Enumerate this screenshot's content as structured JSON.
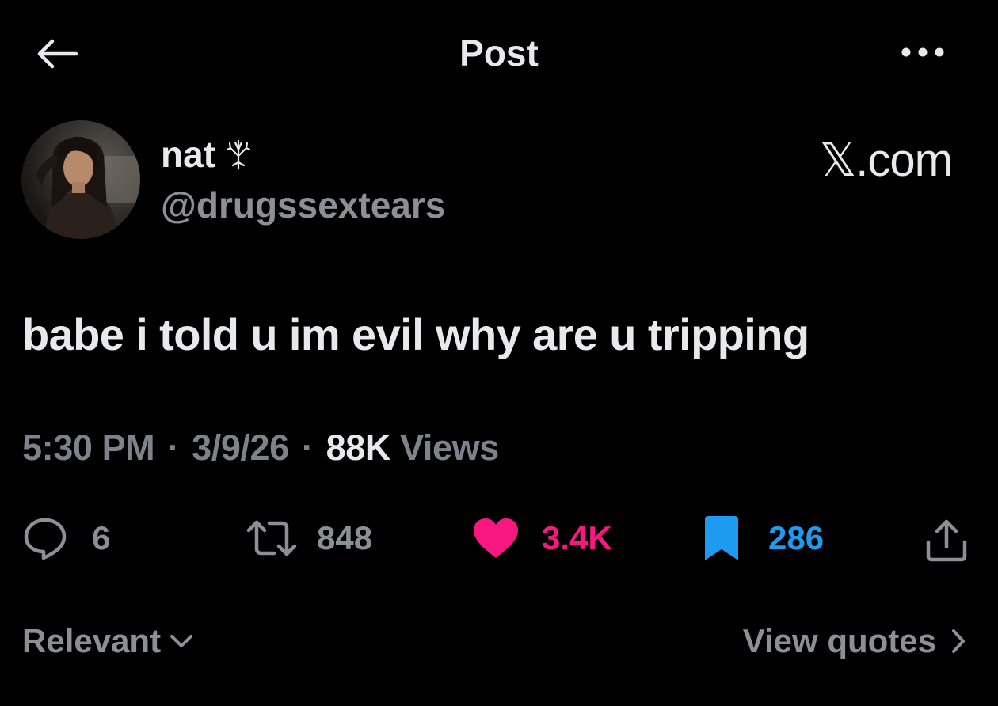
{
  "header": {
    "title": "Post",
    "back_icon": "arrow-left-icon",
    "more_icon": "more-horizontal-icon"
  },
  "author": {
    "display_name": "nat",
    "name_emoji_icon": "tree-glyph-icon",
    "handle": "@drugssextears"
  },
  "watermark": "𝕏.com",
  "tweet": {
    "text": "babe i told u im evil why are u tripping",
    "time": "5:30 PM",
    "date": "3/9/26",
    "separator": "·",
    "views_count": "88K",
    "views_label": "Views"
  },
  "actions": {
    "replies": "6",
    "reposts": "848",
    "likes": "3.4K",
    "bookmarks": "286"
  },
  "footer": {
    "sort_label": "Relevant",
    "view_quotes_label": "View quotes"
  },
  "colors": {
    "background": "#000000",
    "text_primary": "#e7e9ea",
    "text_secondary": "#8b9096",
    "like": "#f91880",
    "bookmark": "#1d9bf0"
  }
}
